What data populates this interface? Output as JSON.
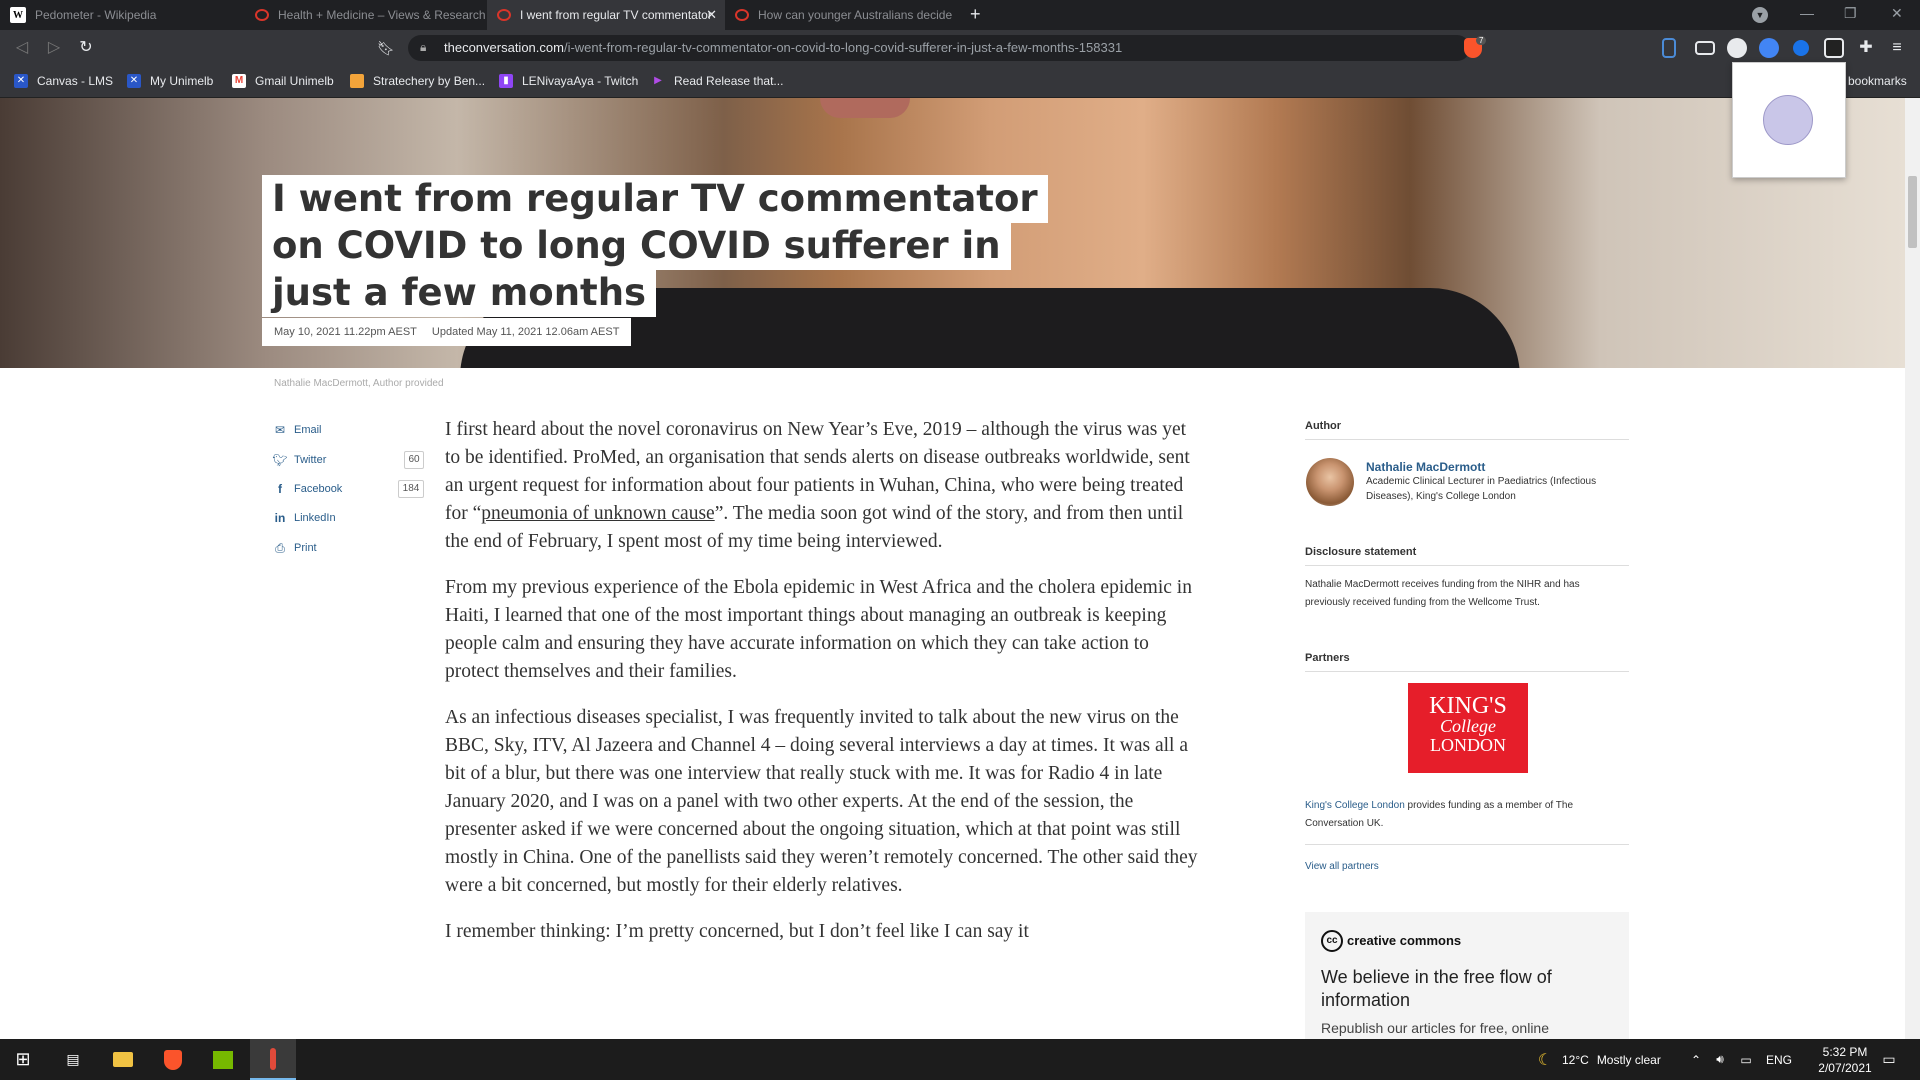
{
  "tabs": [
    {
      "title": "Pedometer - Wikipedia",
      "active": false
    },
    {
      "title": "Health + Medicine – Views & Research",
      "active": false
    },
    {
      "title": "I went from regular TV commentator",
      "active": true
    },
    {
      "title": "How can younger Australians decide",
      "active": false
    }
  ],
  "toolbar": {
    "url_domain": "theconversation.com",
    "url_path": "/i-went-from-regular-tv-commentator-on-covid-to-long-covid-sufferer-in-just-a-few-months-158331",
    "brave_badge": "7"
  },
  "bookmarks": [
    {
      "label": "Canvas - LMS",
      "color": "#2a57c7"
    },
    {
      "label": "My Unimelb",
      "color": "#2a57c7"
    },
    {
      "label": "Gmail Unimelb",
      "color": "#e94235"
    },
    {
      "label": "Stratechery by Ben...",
      "color": "#f3a43a"
    },
    {
      "label": "LENivayaAya - Twitch",
      "color": "#8f45f5"
    },
    {
      "label": "Read Release that...",
      "color": "#6e2ba8"
    }
  ],
  "other_bookmarks": "bookmarks",
  "article": {
    "title": "I went from regular TV commentator on COVID to long COVID sufferer in just a few months",
    "published": "May 10, 2021 11.22pm AEST",
    "updated": "Updated May 11, 2021 12.06am AEST",
    "image_caption": "Nathalie MacDermott, Author provided",
    "link_text": "pneumonia of unknown cause",
    "p1a": "I first heard about the novel coronavirus on New Year’s Eve, 2019 – although the virus was yet to be identified. ProMed, an organisation that sends alerts on disease outbreaks worldwide, sent an urgent request for information about four patients in Wuhan, China, who were being treated for “",
    "p1b": "”. The media soon got wind of the story, and from then until the end of February, I spent most of my time being interviewed.",
    "p2": "From my previous experience of the Ebola epidemic in West Africa and the cholera epidemic in Haiti, I learned that one of the most important things about managing an outbreak is keeping people calm and ensuring they have accurate information on which they can take action to protect themselves and their families.",
    "p3": "As an infectious diseases specialist, I was frequently invited to talk about the new virus on the BBC, Sky, ITV, Al Jazeera and Channel 4 – doing several interviews a day at times. It was all a bit of a blur, but there was one interview that really stuck with me. It was for Radio 4 in late January 2020, and I was on a panel with two other experts. At the end of the session, the presenter asked if we were concerned about the ongoing situation, which at that point was still mostly in China. One of the panellists said they weren’t remotely concerned. The other said they were a bit concerned, but mostly for their elderly relatives.",
    "p4": "I remember thinking: I’m pretty concerned, but I don’t feel like I can say it"
  },
  "share": [
    {
      "label": "Email",
      "icon": "envelope-icon",
      "count": ""
    },
    {
      "label": "Twitter",
      "icon": "twitter-icon",
      "count": "60"
    },
    {
      "label": "Facebook",
      "icon": "facebook-icon",
      "count": "184"
    },
    {
      "label": "LinkedIn",
      "icon": "linkedin-icon",
      "count": ""
    },
    {
      "label": "Print",
      "icon": "printer-icon",
      "count": ""
    }
  ],
  "sidebar": {
    "author_heading": "Author",
    "author_name": "Nathalie MacDermott",
    "author_role": "Academic Clinical Lecturer in Paediatrics (Infectious Diseases), King's College London",
    "disclosure_heading": "Disclosure statement",
    "disclosure_text": "Nathalie MacDermott receives funding from the NIHR and has previously received funding from the Wellcome Trust.",
    "partners_heading": "Partners",
    "kcl_logo": [
      "KING'S",
      "College",
      "LONDON"
    ],
    "partner_link": "King's College London",
    "partner_text": " provides funding as a member of The Conversation UK.",
    "view_partners": "View all partners",
    "cc_logo": "creative commons",
    "cc_heading": "We believe in the free flow of information",
    "cc_text": "Republish our articles for free, online"
  },
  "taskbar": {
    "weather_temp": "12°C",
    "weather_desc": "Mostly clear",
    "lang": "ENG",
    "time": "5:32 PM",
    "date": "2/07/2021"
  }
}
